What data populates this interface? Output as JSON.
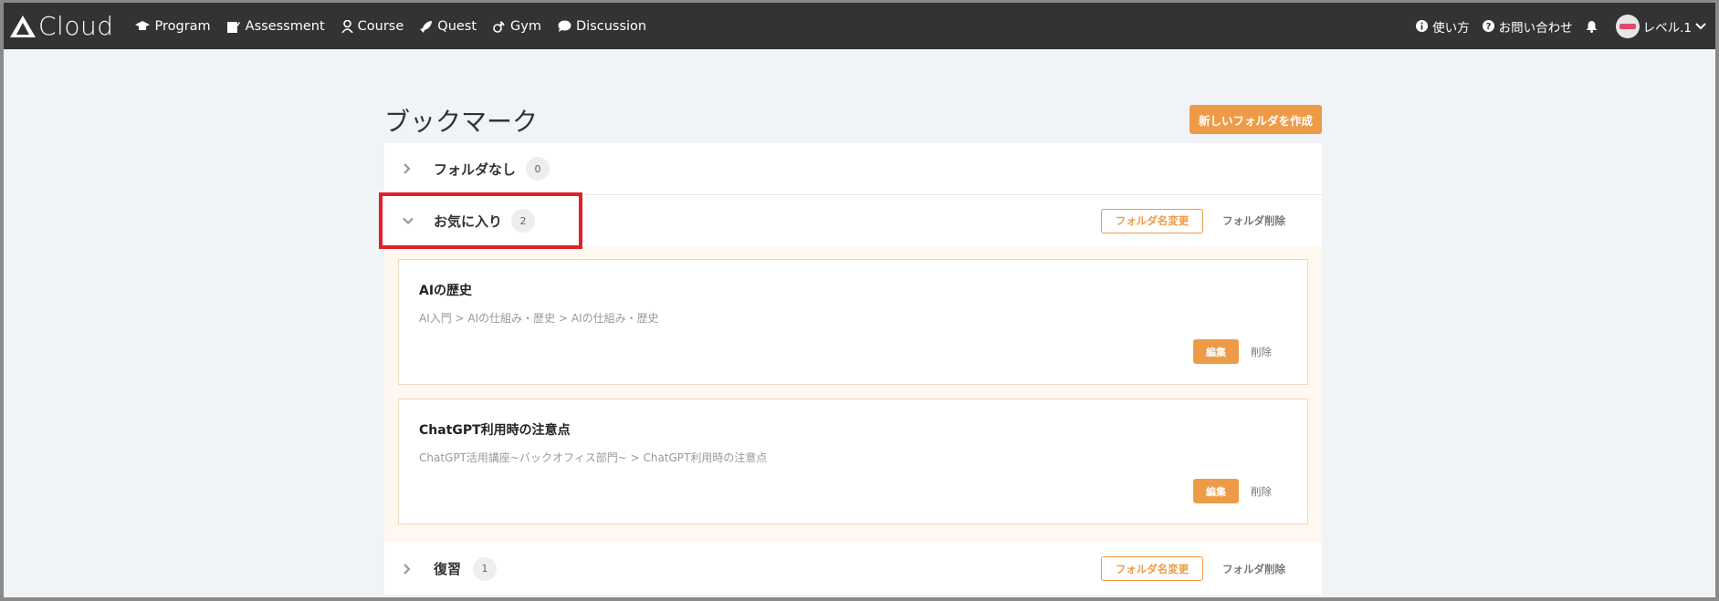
{
  "app": {
    "logo_text": "Cloud"
  },
  "nav": {
    "items": [
      {
        "label": "Program",
        "icon": "graduation-cap-icon"
      },
      {
        "label": "Assessment",
        "icon": "edit-icon"
      },
      {
        "label": "Course",
        "icon": "user-icon"
      },
      {
        "label": "Quest",
        "icon": "rocket-icon"
      },
      {
        "label": "Gym",
        "icon": "satellite-icon"
      },
      {
        "label": "Discussion",
        "icon": "comment-icon"
      }
    ],
    "right": {
      "howto": "使い方",
      "contact": "お問い合わせ",
      "level": "レベル.1"
    }
  },
  "page": {
    "title": "ブックマーク",
    "new_folder_label": "新しいフォルダを作成"
  },
  "folders": [
    {
      "name": "フォルダなし",
      "count": "0",
      "expanded": false
    },
    {
      "name": "お気に入り",
      "count": "2",
      "expanded": true,
      "rename_label": "フォルダ名変更",
      "delete_label": "フォルダ削除",
      "bookmarks": [
        {
          "title": "AIの歴史",
          "path": "AI入門 > AIの仕組み・歴史 > AIの仕組み・歴史",
          "edit_label": "編集",
          "delete_label": "削除"
        },
        {
          "title": "ChatGPT利用時の注意点",
          "path": "ChatGPT活用講座~バックオフィス部門~ > ChatGPT利用時の注意点",
          "edit_label": "編集",
          "delete_label": "削除"
        }
      ]
    },
    {
      "name": "復習",
      "count": "1",
      "expanded": false,
      "rename_label": "フォルダ名変更",
      "delete_label": "フォルダ削除"
    }
  ],
  "colors": {
    "accent": "#ee9b48",
    "topbar": "#333333",
    "highlight": "#e0202a"
  }
}
